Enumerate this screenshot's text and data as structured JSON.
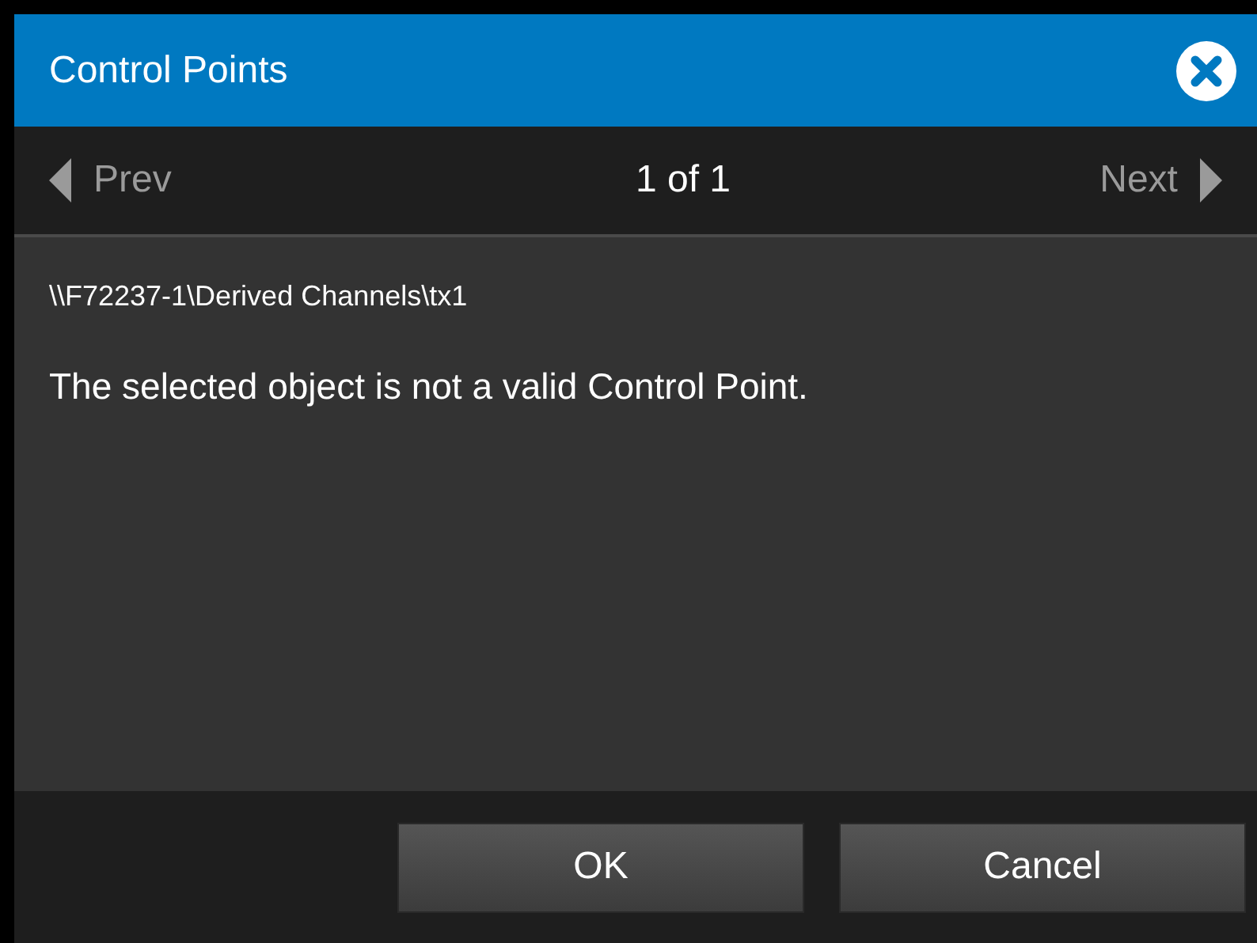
{
  "dialog": {
    "title": "Control Points"
  },
  "navigation": {
    "prev": {
      "label": "Prev",
      "disabled": true
    },
    "position": "1 of 1",
    "next": {
      "label": "Next",
      "disabled": true
    }
  },
  "content": {
    "path": "\\\\F72237-1\\Derived Channels\\tx1",
    "message": "The selected object is not a valid Control Point."
  },
  "buttons": [
    {
      "label": "OK"
    },
    {
      "label": "Cancel"
    }
  ]
}
